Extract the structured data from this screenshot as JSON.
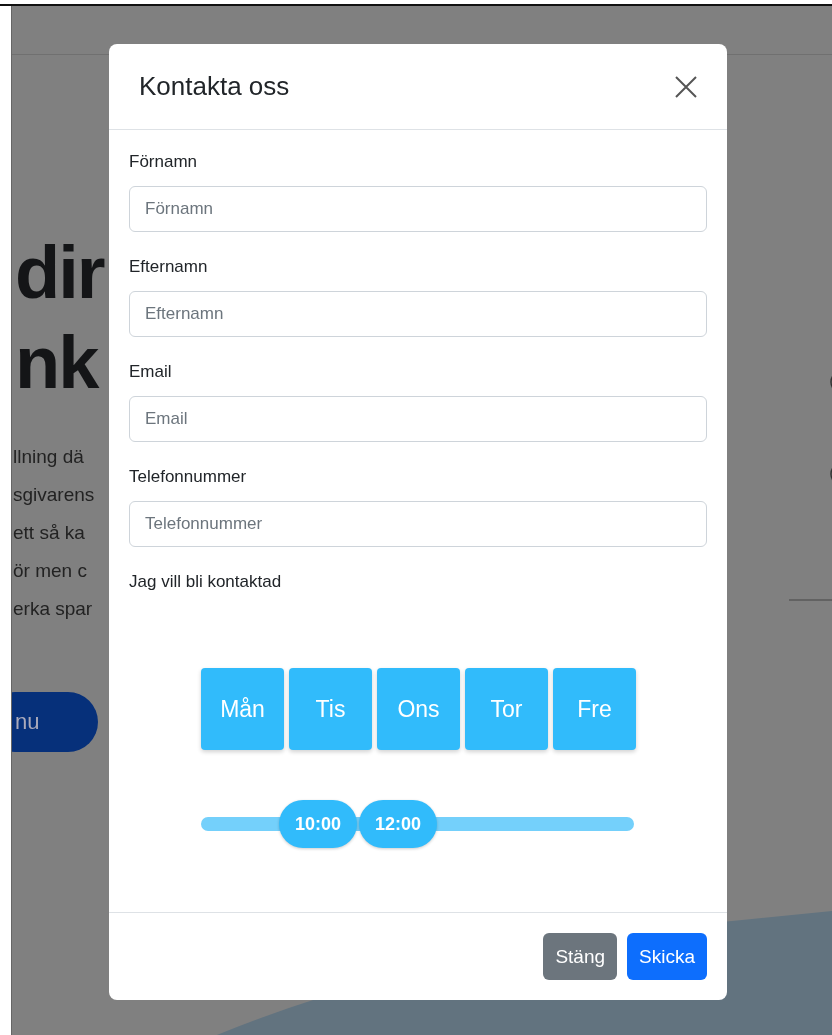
{
  "background": {
    "heading": [
      "dir",
      "nk"
    ],
    "paragraph": [
      "llning dä",
      "sgivarens",
      "ett så ka",
      "ör men c",
      "erka spar"
    ],
    "button": "nu"
  },
  "modal": {
    "title": "Kontakta oss",
    "fields": [
      {
        "label": "Förnamn",
        "placeholder": "Förnamn"
      },
      {
        "label": "Efternamn",
        "placeholder": "Efternamn"
      },
      {
        "label": "Email",
        "placeholder": "Email"
      },
      {
        "label": "Telefonnummer",
        "placeholder": "Telefonnummer"
      }
    ],
    "contact_label": "Jag vill bli kontaktad",
    "days": [
      "Mån",
      "Tis",
      "Ons",
      "Tor",
      "Fre"
    ],
    "time_slider": {
      "handles": [
        {
          "label": "10:00",
          "level": 0.27
        },
        {
          "label": "12:00",
          "level": 0.455
        }
      ]
    },
    "buttons": [
      {
        "label": "Stäng",
        "kind": "secondary"
      },
      {
        "label": "Skicka",
        "kind": "primary"
      }
    ]
  }
}
